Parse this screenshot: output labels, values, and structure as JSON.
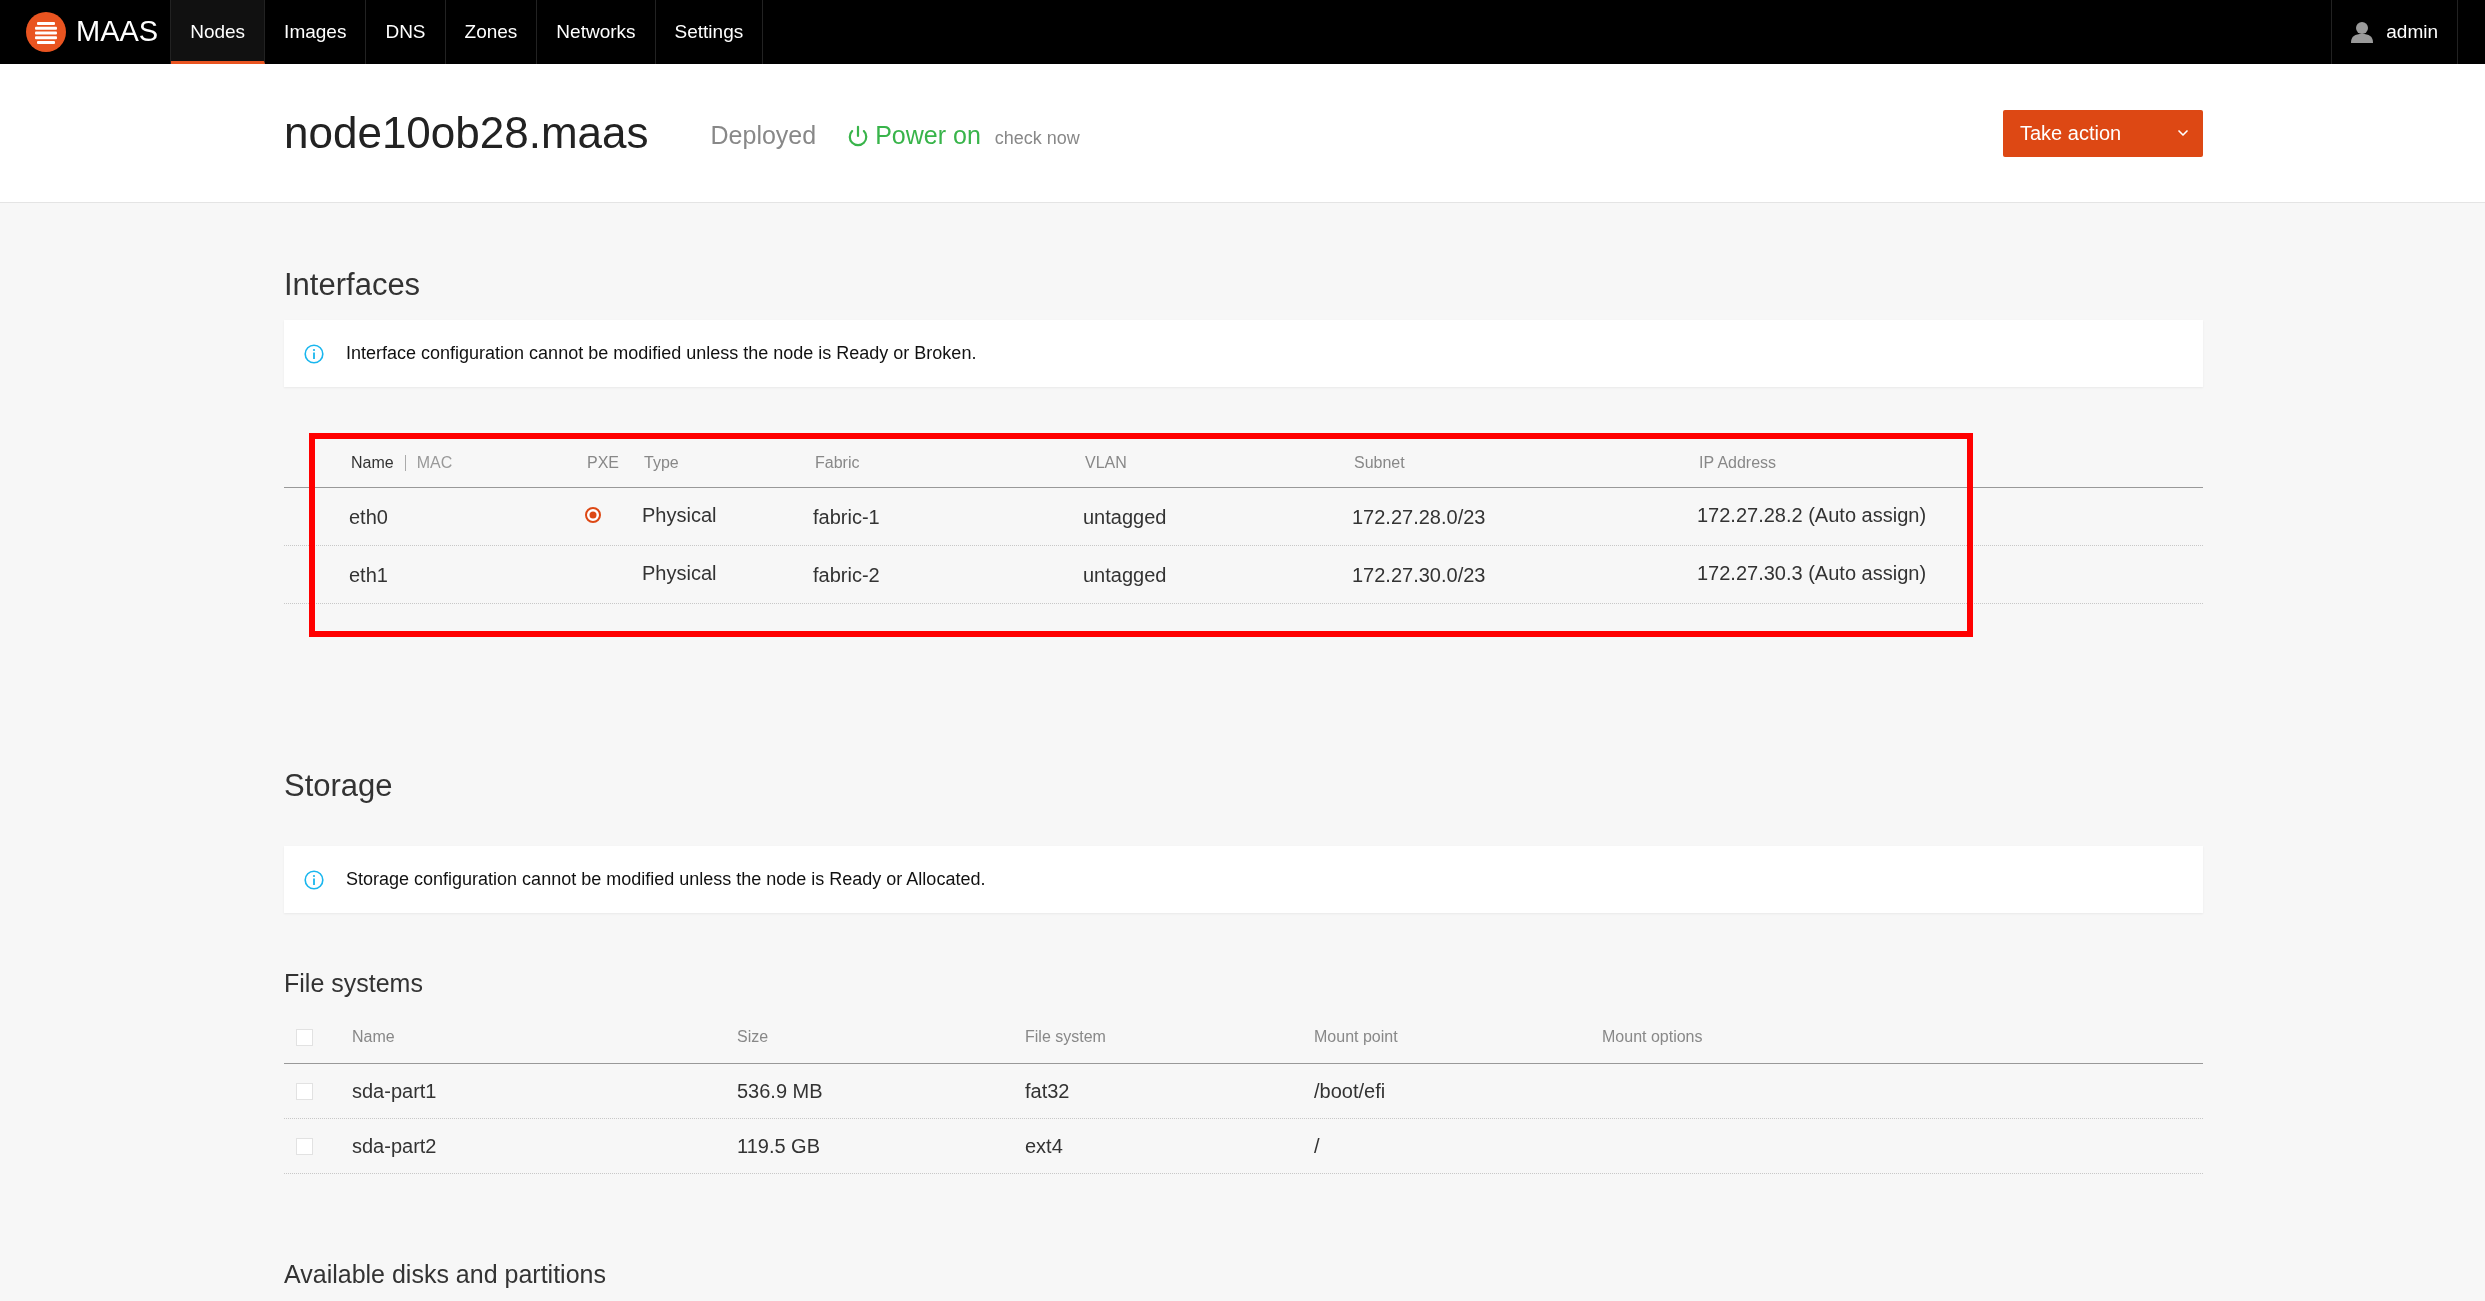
{
  "top_nav": {
    "logo": "MAAS",
    "items": [
      {
        "label": "Nodes",
        "selected": true
      },
      {
        "label": "Images",
        "selected": false
      },
      {
        "label": "DNS",
        "selected": false
      },
      {
        "label": "Zones",
        "selected": false
      },
      {
        "label": "Networks",
        "selected": false
      },
      {
        "label": "Settings",
        "selected": false
      }
    ],
    "user": "admin"
  },
  "header": {
    "title": "node10ob28.maas",
    "status": "Deployed",
    "power": {
      "label": "Power on",
      "on": true
    },
    "check_link": "check now",
    "action_button": "Take action"
  },
  "interfaces": {
    "heading": "Interfaces",
    "notice": "Interface configuration cannot be modified unless the node is Ready or Broken.",
    "name_toggle": [
      {
        "label": "Name",
        "selected": true
      },
      {
        "label": "MAC",
        "selected": false
      }
    ],
    "columns": [
      "PXE",
      "Type",
      "Fabric",
      "VLAN",
      "Subnet",
      "IP Address"
    ],
    "rows": [
      {
        "name": "eth0",
        "pxe": true,
        "type": "Physical",
        "fabric": "fabric-1",
        "vlan": "untagged",
        "subnet": "172.27.28.0/23",
        "ip_address": "172.27.28.2 (Auto assign)"
      },
      {
        "name": "eth1",
        "pxe": false,
        "type": "Physical",
        "fabric": "fabric-2",
        "vlan": "untagged",
        "subnet": "172.27.30.0/23",
        "ip_address": "172.27.30.3 (Auto assign)"
      }
    ]
  },
  "storage": {
    "heading": "Storage",
    "notice": "Storage configuration cannot be modified unless the node is Ready or Allocated.",
    "file_systems": {
      "heading": "File systems",
      "select_all_checked": false,
      "columns": [
        "Name",
        "Size",
        "File system",
        "Mount point",
        "Mount options"
      ],
      "rows": [
        {
          "checked": false,
          "name": "sda-part1",
          "size": "536.9 MB",
          "file_system": "fat32",
          "mount_point": "/boot/efi"
        },
        {
          "checked": false,
          "name": "sda-part2",
          "size": "119.5 GB",
          "file_system": "ext4",
          "mount_point": "/"
        }
      ]
    },
    "available_heading": "Available disks and partitions"
  }
}
